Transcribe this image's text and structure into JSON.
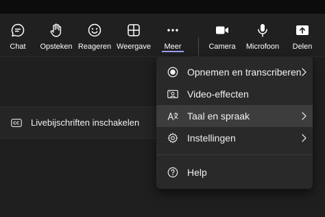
{
  "toolbar": {
    "chat": {
      "label": "Chat",
      "icon": "chat-icon"
    },
    "raise": {
      "label": "Opsteken",
      "icon": "hand-icon"
    },
    "react": {
      "label": "Reageren",
      "icon": "smiley-icon"
    },
    "view": {
      "label": "Weergave",
      "icon": "grid-icon"
    },
    "more": {
      "label": "Meer",
      "icon": "more-dots-icon"
    },
    "camera": {
      "label": "Camera",
      "icon": "camera-icon"
    },
    "mic": {
      "label": "Microfoon",
      "icon": "microphone-icon"
    },
    "share": {
      "label": "Delen",
      "icon": "share-icon"
    }
  },
  "captions": {
    "label": "Livebijschriften inschakelen",
    "icon": "cc-icon"
  },
  "menu": {
    "items": [
      {
        "label": "Opnemen en transcriberen",
        "icon": "record-icon",
        "submenu": true
      },
      {
        "label": "Video-effecten",
        "icon": "video-effects-icon",
        "submenu": false
      },
      {
        "label": "Taal en spraak",
        "icon": "language-icon",
        "submenu": true
      },
      {
        "label": "Instellingen",
        "icon": "gear-icon",
        "submenu": true
      },
      {
        "label": "Help",
        "icon": "help-icon",
        "submenu": false
      }
    ]
  },
  "colors": {
    "accent": "#9ea2ff",
    "background": "#1f1f1f",
    "menu": "#292929",
    "highlight": "#3d3d3d"
  }
}
